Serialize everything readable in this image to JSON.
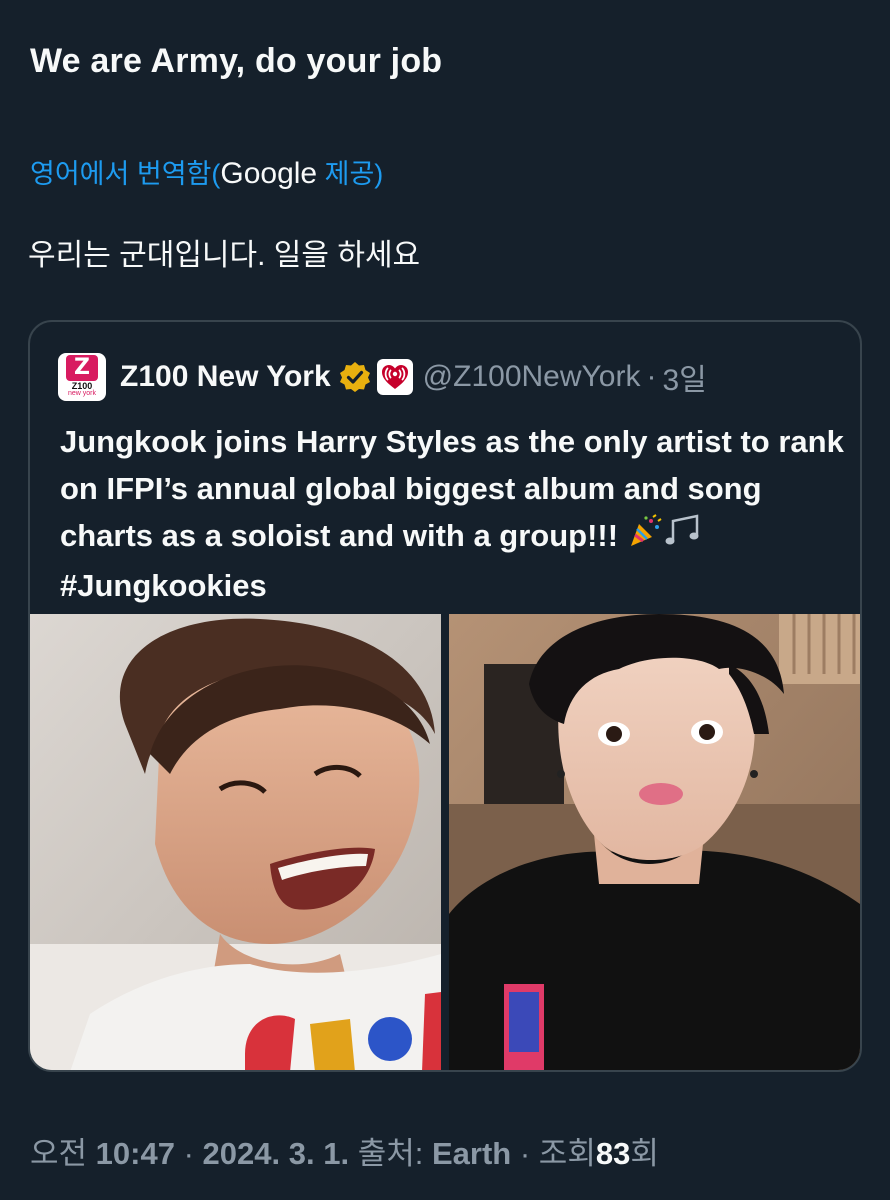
{
  "tweet": {
    "text": "We are Army, do your job"
  },
  "translation": {
    "link_prefix": "영어에서 번역함(",
    "provider": "Google",
    "link_suffix": " 제공)",
    "translated_text": "우리는 군대입니다. 일을 하세요"
  },
  "quote": {
    "avatar_logo_mark": "Z",
    "avatar_logo_number": "Z100",
    "avatar_logo_city": "new york",
    "display_name": "Z100 New York",
    "handle": "@Z100NewYork",
    "separator": "·",
    "time_ago": "3일",
    "body": "Jungkook joins Harry Styles as the only artist to rank on IFPI’s annual global biggest album and song charts as a soloist and with a group!!!",
    "hashtag": "#Jungkookies",
    "emojis": [
      "party-popper-icon",
      "music-notes-icon"
    ],
    "badge_colors": {
      "verified": "#e8b00f",
      "affiliate": "#c6002b"
    }
  },
  "meta": {
    "time_prefix": "오전",
    "time": "10:47",
    "separator": "·",
    "date": "2024. 3. 1.",
    "source_label": "출처:",
    "source": "Earth",
    "views_label": "조회",
    "views": "83",
    "views_suffix": "회"
  }
}
